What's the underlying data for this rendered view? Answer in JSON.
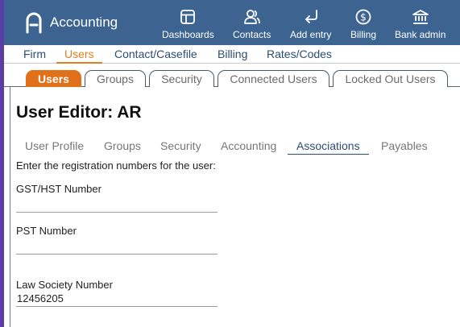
{
  "app": {
    "name": "Accounting"
  },
  "topnav": [
    {
      "label": "Dashboards",
      "icon": "dashboard-icon"
    },
    {
      "label": "Contacts",
      "icon": "contacts-icon"
    },
    {
      "label": "Add entry",
      "icon": "add-entry-icon"
    },
    {
      "label": "Billing",
      "icon": "billing-icon"
    },
    {
      "label": "Bank admin",
      "icon": "bank-icon"
    }
  ],
  "submenu": [
    {
      "label": "Firm",
      "active": false
    },
    {
      "label": "Users",
      "active": true
    },
    {
      "label": "Contact/Casefile",
      "active": false
    },
    {
      "label": "Billing",
      "active": false
    },
    {
      "label": "Rates/Codes",
      "active": false
    }
  ],
  "tabs": [
    {
      "label": "Users",
      "active": true
    },
    {
      "label": "Groups",
      "active": false
    },
    {
      "label": "Security",
      "active": false
    },
    {
      "label": "Connected Users",
      "active": false
    },
    {
      "label": "Locked Out Users",
      "active": false
    }
  ],
  "editor": {
    "title": "User Editor: AR",
    "tabs": [
      {
        "label": "User Profile",
        "active": false
      },
      {
        "label": "Groups",
        "active": false
      },
      {
        "label": "Security",
        "active": false
      },
      {
        "label": "Accounting",
        "active": false
      },
      {
        "label": "Associations",
        "active": true
      },
      {
        "label": "Payables",
        "active": false
      }
    ],
    "hint": "Enter the registration numbers for the user:",
    "fields": [
      {
        "label": "GST/HST Number",
        "value": ""
      },
      {
        "label": "PST Number",
        "value": ""
      },
      {
        "label": "Law Society Number",
        "value": "12456205"
      }
    ]
  },
  "colors": {
    "topbar": "#3d6491",
    "accent": "#e0701a",
    "link": "#2c4d73",
    "left_edge": "#5b3da8"
  }
}
